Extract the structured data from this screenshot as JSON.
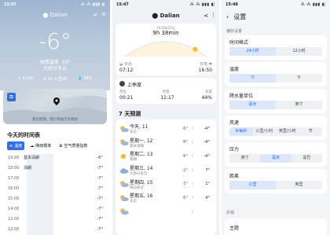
{
  "panel1": {
    "status": {
      "time": "15:47",
      "icons": "⁂ ⁂ ▮▮▮ ◧"
    },
    "city": "Dalian",
    "temp": "-6°",
    "feels": "体感温度 -10°",
    "condition": "大部分多云",
    "stats": [
      {
        "icon": "☀",
        "text": "8 UVI"
      },
      {
        "icon": "◎",
        "text": "41 公里/时"
      },
      {
        "icon": "💧",
        "text": "58%"
      }
    ],
    "map_caption": "雷达图像。我们要展示的模板",
    "hourly_title": "今天的时间表",
    "tabs": [
      {
        "icon": "≡",
        "label": "温度"
      },
      {
        "icon": "☁",
        "label": "降雨概率"
      },
      {
        "icon": "✿",
        "label": "空气质量指数"
      }
    ],
    "hours": [
      {
        "time": "19:00",
        "desc": "基本清朗",
        "val": "-6°"
      },
      {
        "time": "18:00",
        "desc": "清朗",
        "val": "-7°"
      },
      {
        "time": "17:00",
        "desc": "",
        "val": "-7°"
      },
      {
        "time": "16:00",
        "desc": "",
        "val": "-7°"
      },
      {
        "time": "15:00",
        "desc": "",
        "val": "-7°"
      },
      {
        "time": "14:00",
        "desc": "",
        "val": "-7°"
      },
      {
        "time": "13:00",
        "desc": "",
        "val": "-7°"
      },
      {
        "time": "12:00",
        "desc": "",
        "val": "-7°"
      }
    ]
  },
  "panel2": {
    "status": {
      "time": "15:47",
      "icons": "⁂ ⁂ ▮▮▮ ◧"
    },
    "city": "Dalian",
    "sun": {
      "date": "2024年01月",
      "duration": "9h 38min",
      "rise_label": "日出",
      "rise_time": "07:12",
      "set_label": "日落",
      "set_time": "16:50",
      "progress": 0.86
    },
    "moon": {
      "phase": "上季度",
      "labels": [
        "月出",
        "月落",
        "亮度"
      ],
      "values": [
        "00:21",
        "11:17",
        "44%"
      ]
    },
    "forecast_title": "7 天预测",
    "forecast": [
      {
        "day": "今天, 11",
        "cond": "多云",
        "lo": "-6°",
        "hi": "-4°",
        "icon": "sun-cloud"
      },
      {
        "day": "星期一, 12",
        "cond": "基本清朗",
        "lo": "-8°",
        "hi": "-4°",
        "icon": "sun-cloud"
      },
      {
        "day": "星期二, 13",
        "cond": "清朗",
        "lo": "-6°",
        "hi": "-4°",
        "icon": "sun"
      },
      {
        "day": "星期三, 14",
        "cond": "大部分多云",
        "lo": "-2°",
        "hi": "7°",
        "icon": "cloud"
      },
      {
        "day": "星期四, 15",
        "cond": "晴间多云",
        "lo": "-3°",
        "hi": "1°",
        "icon": "sun-cloud"
      },
      {
        "day": "星期五, 16",
        "cond": "多云",
        "lo": "-6°",
        "hi": "4°",
        "icon": "sun-cloud"
      },
      {
        "day": "",
        "cond": "",
        "lo": "",
        "hi": "",
        "icon": "sun-cloud"
      }
    ]
  },
  "panel3": {
    "status": {
      "time": "15:48",
      "icons": "⁂ ⁂ ▮▮▮ ◧"
    },
    "title": "设置",
    "section1": "偏好设置",
    "groups": [
      {
        "title": "时间格式",
        "options": [
          "24小时",
          "12小时"
        ],
        "selected": 0
      },
      {
        "title": "温度",
        "options": [
          "℃",
          "℉"
        ],
        "selected": 0
      },
      {
        "title": "降水量单位",
        "options": [
          "毫米",
          "英寸"
        ],
        "selected": 0
      },
      {
        "title": "风速",
        "options": [
          "米每秒",
          "公里/小时",
          "英里/小时",
          "节"
        ],
        "selected": 0
      },
      {
        "title": "压力",
        "options": [
          "英寸",
          "毫米",
          "毫巴"
        ],
        "selected": 1
      },
      {
        "title": "距离",
        "options": [
          "公里",
          "英里"
        ],
        "selected": 0
      }
    ],
    "section2": "外观",
    "theme_title": "主题"
  },
  "colors": {
    "accent": "#2f6fe0",
    "accent_light": "#dce7fb",
    "sun_yellow": "#f5b942"
  }
}
